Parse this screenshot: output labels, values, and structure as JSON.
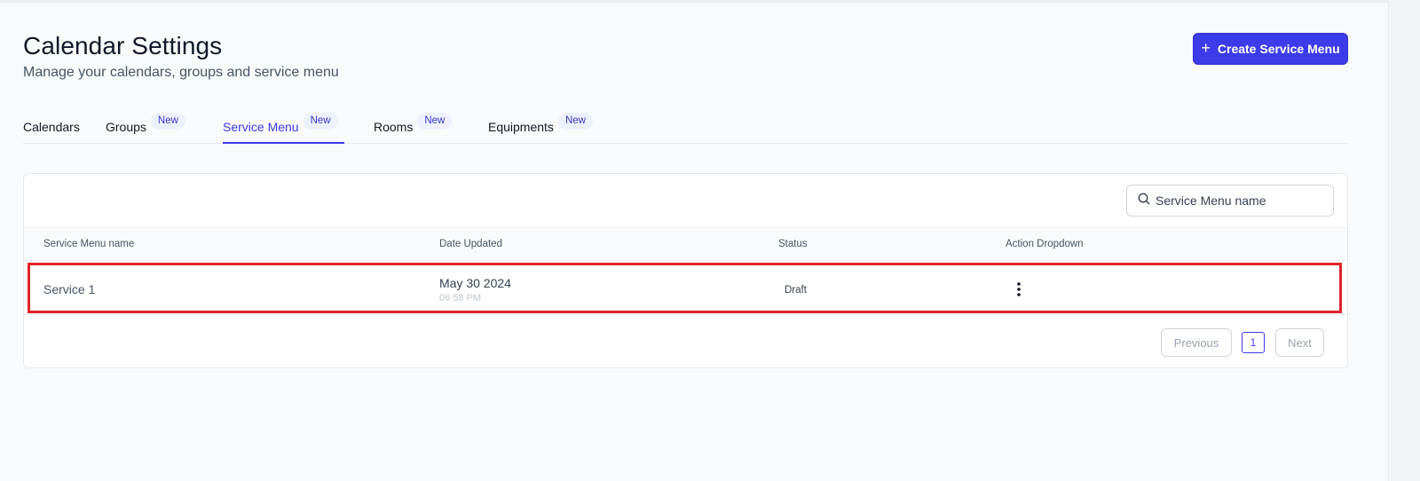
{
  "header": {
    "title": "Calendar Settings",
    "subtitle": "Manage your calendars, groups and service menu",
    "create_button_label": "Create Service Menu",
    "create_button_icon": "plus-icon"
  },
  "tabs": [
    {
      "label": "Calendars",
      "badge": "",
      "active": false
    },
    {
      "label": "Groups",
      "badge": "New",
      "active": false
    },
    {
      "label": "Service Menu",
      "badge": "New",
      "active": true
    },
    {
      "label": "Rooms",
      "badge": "New",
      "active": false
    },
    {
      "label": "Equipments",
      "badge": "New",
      "active": false
    }
  ],
  "search": {
    "placeholder": "Service Menu name",
    "value": "",
    "icon": "search-icon"
  },
  "table": {
    "columns": [
      "Service Menu name",
      "Date Updated",
      "Status",
      "Action Dropdown"
    ],
    "rows": [
      {
        "name": "Service 1",
        "date": "May 30 2024",
        "time": "06 58 PM",
        "status": "Draft",
        "action_icon": "kebab-menu-icon"
      }
    ]
  },
  "pagination": {
    "previous_label": "Previous",
    "current_page": "1",
    "next_label": "Next"
  },
  "colors": {
    "accent": "#3c3cea",
    "badge_bg": "#eef0fd",
    "highlight_border": "#e0222b"
  }
}
